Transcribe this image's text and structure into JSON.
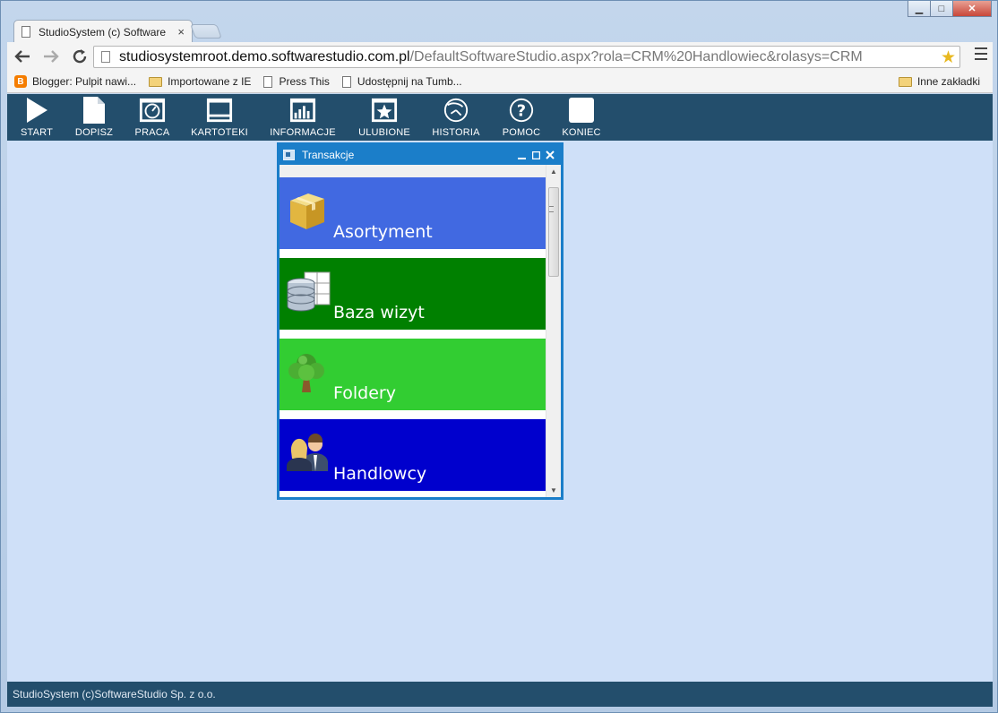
{
  "browser": {
    "tab_title": "StudioSystem (c) Software",
    "tab_close": "×",
    "url_host": "studiosystemroot.demo.softwarestudio.com.pl",
    "url_path": "/DefaultSoftwareStudio.aspx?rola=CRM%20Handlowiec&rolasys=CRM",
    "bookmarks": [
      {
        "label": "Blogger: Pulpit nawi...",
        "icon": "blogger-icon"
      },
      {
        "label": "Importowane z IE",
        "icon": "folder-icon"
      },
      {
        "label": "Press This",
        "icon": "page-icon"
      },
      {
        "label": "Udostępnij na Tumb...",
        "icon": "page-icon"
      }
    ],
    "other_bookmarks": "Inne zakładki"
  },
  "app": {
    "toolbar": [
      {
        "label": "START",
        "icon": "play-icon"
      },
      {
        "label": "DOPISZ",
        "icon": "document-icon"
      },
      {
        "label": "PRACA",
        "icon": "dashboard-icon"
      },
      {
        "label": "KARTOTEKI",
        "icon": "monitor-icon"
      },
      {
        "label": "INFORMACJE",
        "icon": "chart-icon"
      },
      {
        "label": "ULUBIONE",
        "icon": "star-icon"
      },
      {
        "label": "HISTORIA",
        "icon": "history-icon"
      },
      {
        "label": "POMOC",
        "icon": "help-icon"
      },
      {
        "label": "KONIEC",
        "icon": "exit-icon"
      }
    ],
    "status": "StudioSystem (c)SoftwareStudio Sp. z o.o."
  },
  "dialog": {
    "title": "Transakcje",
    "tiles": [
      {
        "label": "Asortyment",
        "color": "#4169e1",
        "icon": "box-icon"
      },
      {
        "label": "Baza wizyt",
        "color": "#008000",
        "icon": "database-icon"
      },
      {
        "label": "Foldery",
        "color": "#32cd32",
        "icon": "tree-icon"
      },
      {
        "label": "Handlowcy",
        "color": "#0000cd",
        "icon": "people-icon"
      }
    ]
  }
}
